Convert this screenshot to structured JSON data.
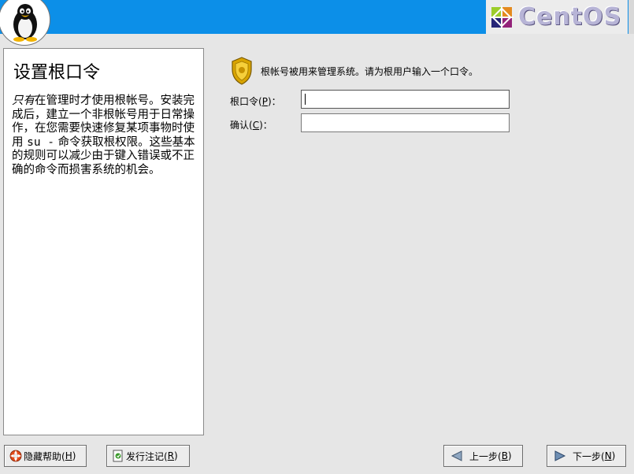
{
  "header": {
    "brand": "CentOS",
    "icons": [
      "tux-penguin-icon",
      "centos-pinwheel-icon"
    ]
  },
  "help": {
    "title": "设置根口令",
    "emph": "只有",
    "body_part1": "在管理时才使用根帐号。安装完成后，建立一个非根帐号用于日常操作，在您需要快速修复某项事物时使用 ",
    "command": "su -",
    "body_part2": " 命令获取根权限。这些基本的规则可以减少由于键入错误或不正确的命令而损害系统的机会。"
  },
  "form": {
    "icon": "police-badge-icon",
    "intro": "根帐号被用来管理系统。请为根用户输入一个口令。",
    "root_password": {
      "label_pre": "根口令(",
      "accel": "P",
      "label_post": ")：",
      "value": ""
    },
    "confirm": {
      "label_pre": "确认(",
      "accel": "C",
      "label_post": ")：",
      "value": ""
    }
  },
  "buttons": {
    "hide_help": {
      "pre": "隐藏帮助(",
      "accel": "H",
      "post": ")",
      "icon": "lifebuoy-icon"
    },
    "release_notes": {
      "pre": "发行注记(",
      "accel": "R",
      "post": ")",
      "icon": "document-icon"
    },
    "back": {
      "pre": "上一步(",
      "accel": "B",
      "post": ")",
      "icon": "arrow-left-icon"
    },
    "next": {
      "pre": "下一步(",
      "accel": "N",
      "post": ")",
      "icon": "arrow-right-icon"
    }
  },
  "colors": {
    "header": "#0c8fe8",
    "background": "#e6e6e6",
    "panel": "#ffffff",
    "brand_text": "#b7b4d6"
  }
}
